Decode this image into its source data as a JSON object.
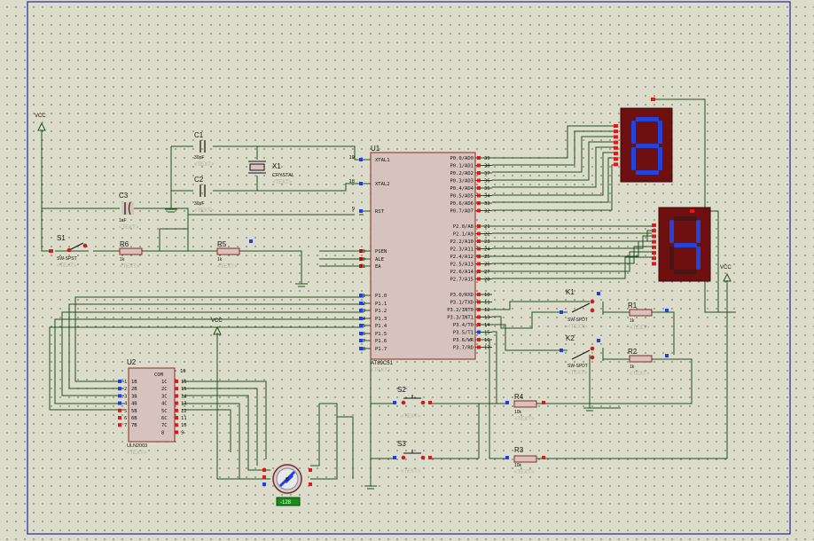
{
  "colors": {
    "sheet_border": "#2222aa",
    "wire": "#1f4f1f",
    "component_fill": "#d7c3bd",
    "component_outline": "#8a2a2a",
    "pin_red": "#e01818",
    "pin_blue": "#1a3cff",
    "display_bg": "#6e1010",
    "segment_on": "#2244dd",
    "segment_off": "#4a1414",
    "text_placeholder": "#b0b0a0",
    "motor_label_bg": "#1a8a1a"
  },
  "power": {
    "vcc_label": "VCC"
  },
  "mcu": {
    "ref": "U1",
    "part": "AT89C51",
    "text": "<TEXT>",
    "left_pins": [
      {
        "num": "19",
        "name": "XTAL1"
      },
      {
        "num": "18",
        "name": "XTAL2"
      },
      {
        "num": "9",
        "name": "RST"
      },
      {
        "num": "29",
        "name": "PSEN"
      },
      {
        "num": "30",
        "name": "ALE"
      },
      {
        "num": "31",
        "name": "EA"
      },
      {
        "num": "1",
        "name": "P1.0"
      },
      {
        "num": "2",
        "name": "P1.1"
      },
      {
        "num": "3",
        "name": "P1.2"
      },
      {
        "num": "4",
        "name": "P1.3"
      },
      {
        "num": "5",
        "name": "P1.4"
      },
      {
        "num": "6",
        "name": "P1.5"
      },
      {
        "num": "7",
        "name": "P1.6"
      },
      {
        "num": "8",
        "name": "P1.7"
      }
    ],
    "right_pins": [
      {
        "num": "39",
        "name": "P0.0/AD0"
      },
      {
        "num": "38",
        "name": "P0.1/AD1"
      },
      {
        "num": "37",
        "name": "P0.2/AD2"
      },
      {
        "num": "36",
        "name": "P0.3/AD3"
      },
      {
        "num": "35",
        "name": "P0.4/AD4"
      },
      {
        "num": "34",
        "name": "P0.5/AD5"
      },
      {
        "num": "33",
        "name": "P0.6/AD6"
      },
      {
        "num": "32",
        "name": "P0.7/AD7"
      },
      {
        "num": "21",
        "name": "P2.0/A8"
      },
      {
        "num": "22",
        "name": "P2.1/A9"
      },
      {
        "num": "23",
        "name": "P2.2/A10"
      },
      {
        "num": "24",
        "name": "P2.3/A11"
      },
      {
        "num": "25",
        "name": "P2.4/A12"
      },
      {
        "num": "26",
        "name": "P2.5/A13"
      },
      {
        "num": "27",
        "name": "P2.6/A14"
      },
      {
        "num": "28",
        "name": "P2.7/A15"
      },
      {
        "num": "10",
        "name": "P3.0/RXD"
      },
      {
        "num": "11",
        "name": "P3.1/TXD"
      },
      {
        "num": "12",
        "name": "P3.2/INT0"
      },
      {
        "num": "13",
        "name": "P3.3/INT1"
      },
      {
        "num": "14",
        "name": "P3.4/T0"
      },
      {
        "num": "15",
        "name": "P3.5/T1"
      },
      {
        "num": "16",
        "name": "P3.6/WR"
      },
      {
        "num": "17",
        "name": "P3.7/RD"
      }
    ]
  },
  "driver": {
    "ref": "U2",
    "part": "ULN2003",
    "text": "<TEXT>",
    "com_label": "COM",
    "com_num": "10",
    "left": [
      {
        "num": "1",
        "name": "1B"
      },
      {
        "num": "2",
        "name": "2B"
      },
      {
        "num": "3",
        "name": "3B"
      },
      {
        "num": "4",
        "name": "4B"
      },
      {
        "num": "5",
        "name": "5B"
      },
      {
        "num": "6",
        "name": "6B"
      },
      {
        "num": "7",
        "name": "7B"
      }
    ],
    "right": [
      {
        "num": "16",
        "name": "1C"
      },
      {
        "num": "15",
        "name": "2C"
      },
      {
        "num": "14",
        "name": "3C"
      },
      {
        "num": "13",
        "name": "4C"
      },
      {
        "num": "12",
        "name": "5C"
      },
      {
        "num": "11",
        "name": "6C"
      },
      {
        "num": "10",
        "name": "7C"
      },
      {
        "num": "9",
        "name": "8"
      }
    ]
  },
  "displays": [
    {
      "digit": "8"
    },
    {
      "digit": "4"
    }
  ],
  "components": {
    "c1": {
      "ref": "C1",
      "value": "30pF",
      "text": "<TEXT>"
    },
    "c2": {
      "ref": "C2",
      "value": "30pF",
      "text": "<TEXT>"
    },
    "c3": {
      "ref": "C3",
      "value": "1uF",
      "text": "<TEXT>"
    },
    "x1": {
      "ref": "X1",
      "value": "CRYSTAL",
      "text": "<TEXT>"
    },
    "s1": {
      "ref": "S1",
      "value": "SW-SPST",
      "text": "<TEXT>"
    },
    "r6": {
      "ref": "R6",
      "value": "1k",
      "text": "<TEXT>"
    },
    "r5": {
      "ref": "R5",
      "value": "1k",
      "text": "<TEXT>"
    },
    "k1": {
      "ref": "K1",
      "value": "SW-SPDT",
      "text": "<TEXT>"
    },
    "k2": {
      "ref": "K2",
      "value": "SW-SPDT",
      "text": "<TEXT>"
    },
    "r1": {
      "ref": "R1",
      "value": "1k",
      "text": "<TEXT>"
    },
    "r2": {
      "ref": "R2",
      "value": "1k",
      "text": "<TEXT>"
    },
    "s2": {
      "ref": "S2",
      "text": "<TEXT>"
    },
    "s3": {
      "ref": "S3",
      "text": "<TEXT>"
    },
    "r4": {
      "ref": "R4",
      "value": "10k",
      "text": "<TEXT>"
    },
    "r3": {
      "ref": "R3",
      "value": "10k",
      "text": "<TEXT>"
    },
    "motor": {
      "value": "-128"
    }
  }
}
